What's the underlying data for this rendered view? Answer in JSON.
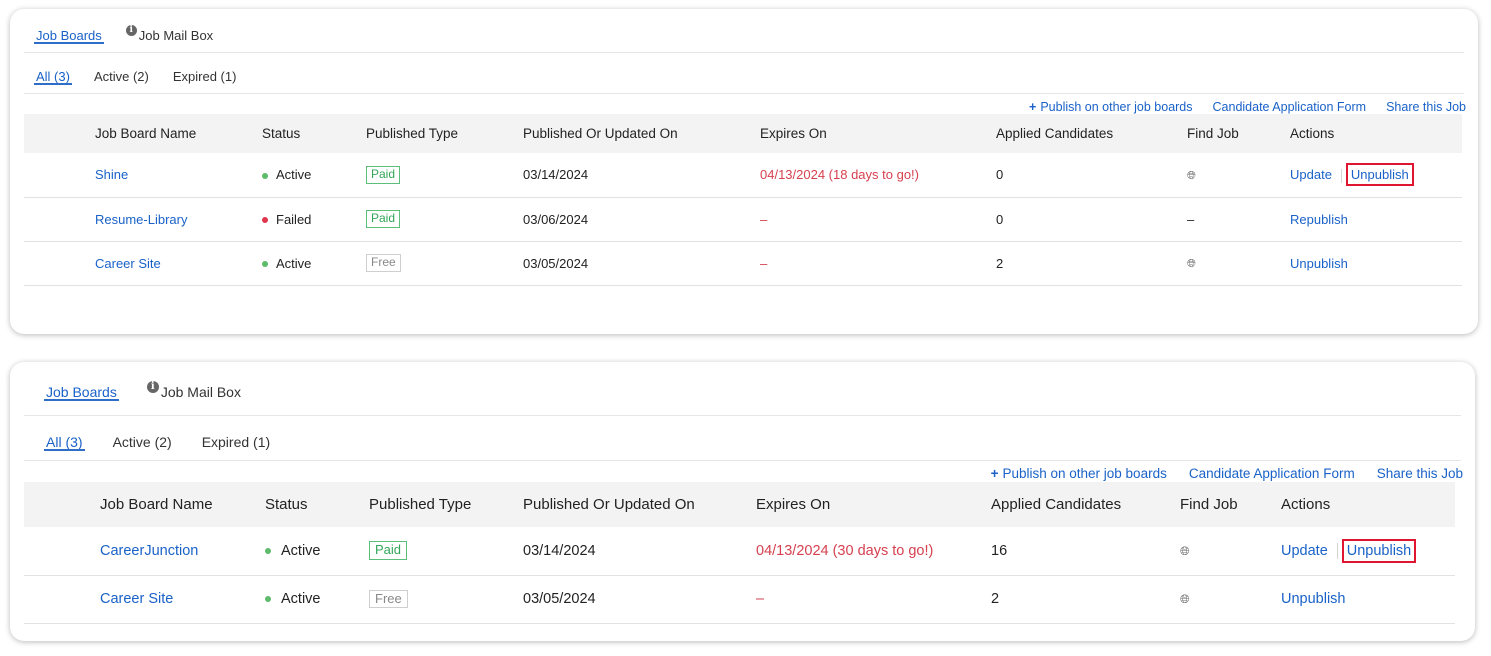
{
  "panels": [
    {
      "tabs": [
        {
          "label": "Job Boards",
          "active": true
        },
        {
          "label": "Job Mail Box",
          "icon": "info-icon"
        }
      ],
      "filters": [
        {
          "label": "All (3)",
          "active": true
        },
        {
          "label": "Active (2)"
        },
        {
          "label": "Expired (1)"
        }
      ],
      "links": {
        "publish_icon": "+",
        "publish": "Publish on other job boards",
        "application_form": "Candidate Application Form",
        "share": "Share this Job"
      },
      "columns": [
        "Job Board Name",
        "Status",
        "Published Type",
        "Published Or Updated On",
        "Expires On",
        "Applied Candidates",
        "Find Job",
        "Actions"
      ],
      "rows": [
        {
          "name": "Shine",
          "status": "Active",
          "type": "Paid",
          "published": "03/14/2024",
          "expires": "04/13/2024 (18 days to go!)",
          "applied": "0",
          "find_job": "globe-icon",
          "actions": [
            "Update",
            "Unpublish"
          ],
          "highlighted": "Unpublish"
        },
        {
          "name": "Resume-Library",
          "status": "Failed",
          "type": "Paid",
          "published": "03/06/2024",
          "expires": "–",
          "applied": "0",
          "find_job": "–",
          "actions": [
            "Republish"
          ]
        },
        {
          "name": "Career Site",
          "status": "Active",
          "type": "Free",
          "published": "03/05/2024",
          "expires": "–",
          "applied": "2",
          "find_job": "globe-icon",
          "actions": [
            "Unpublish"
          ]
        }
      ]
    },
    {
      "tabs": [
        {
          "label": "Job Boards",
          "active": true
        },
        {
          "label": "Job Mail Box",
          "icon": "info-icon"
        }
      ],
      "filters": [
        {
          "label": "All (3)",
          "active": true
        },
        {
          "label": "Active (2)"
        },
        {
          "label": "Expired (1)"
        }
      ],
      "links": {
        "publish_icon": "+",
        "publish": "Publish on other job boards",
        "application_form": "Candidate Application Form",
        "share": "Share this Job"
      },
      "columns": [
        "Job Board Name",
        "Status",
        "Published Type",
        "Published Or Updated On",
        "Expires On",
        "Applied Candidates",
        "Find Job",
        "Actions"
      ],
      "rows": [
        {
          "name": "CareerJunction",
          "status": "Active",
          "type": "Paid",
          "published": "03/14/2024",
          "expires": "04/13/2024 (30 days to go!)",
          "applied": "16",
          "find_job": "globe-icon",
          "actions": [
            "Update",
            "Unpublish"
          ],
          "highlighted": "Unpublish"
        },
        {
          "name": "Career Site",
          "status": "Active",
          "type": "Free",
          "published": "03/05/2024",
          "expires": "–",
          "applied": "2",
          "find_job": "globe-icon",
          "actions": [
            "Unpublish"
          ]
        }
      ]
    }
  ],
  "colors": {
    "link": "#1a62c8",
    "active_status": "#5dbb69",
    "failed_status": "#e0354e",
    "paid_badge": "#32a658",
    "expiry_text": "#d6404f",
    "highlight_box": "#e0152f"
  }
}
